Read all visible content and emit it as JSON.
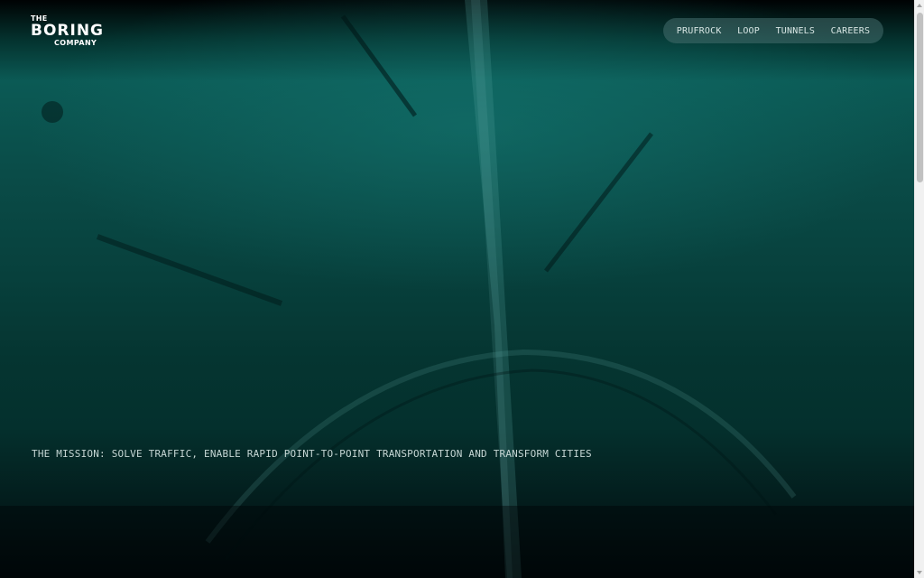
{
  "brand": {
    "line1": "THE",
    "line2": "BORING",
    "line3": "COMPANY"
  },
  "nav": {
    "items": [
      {
        "label": "PRUFROCK"
      },
      {
        "label": "LOOP"
      },
      {
        "label": "TUNNELS"
      },
      {
        "label": "CAREERS"
      }
    ]
  },
  "hero": {
    "mission": "THE MISSION: SOLVE TRAFFIC, ENABLE RAPID POINT-TO-POINT TRANSPORTATION AND TRANSFORM CITIES"
  },
  "colors": {
    "teal": "#0b5a55",
    "deep": "#031b1b",
    "nav_pill": "#466e6e",
    "text": "#c6d6d4"
  }
}
